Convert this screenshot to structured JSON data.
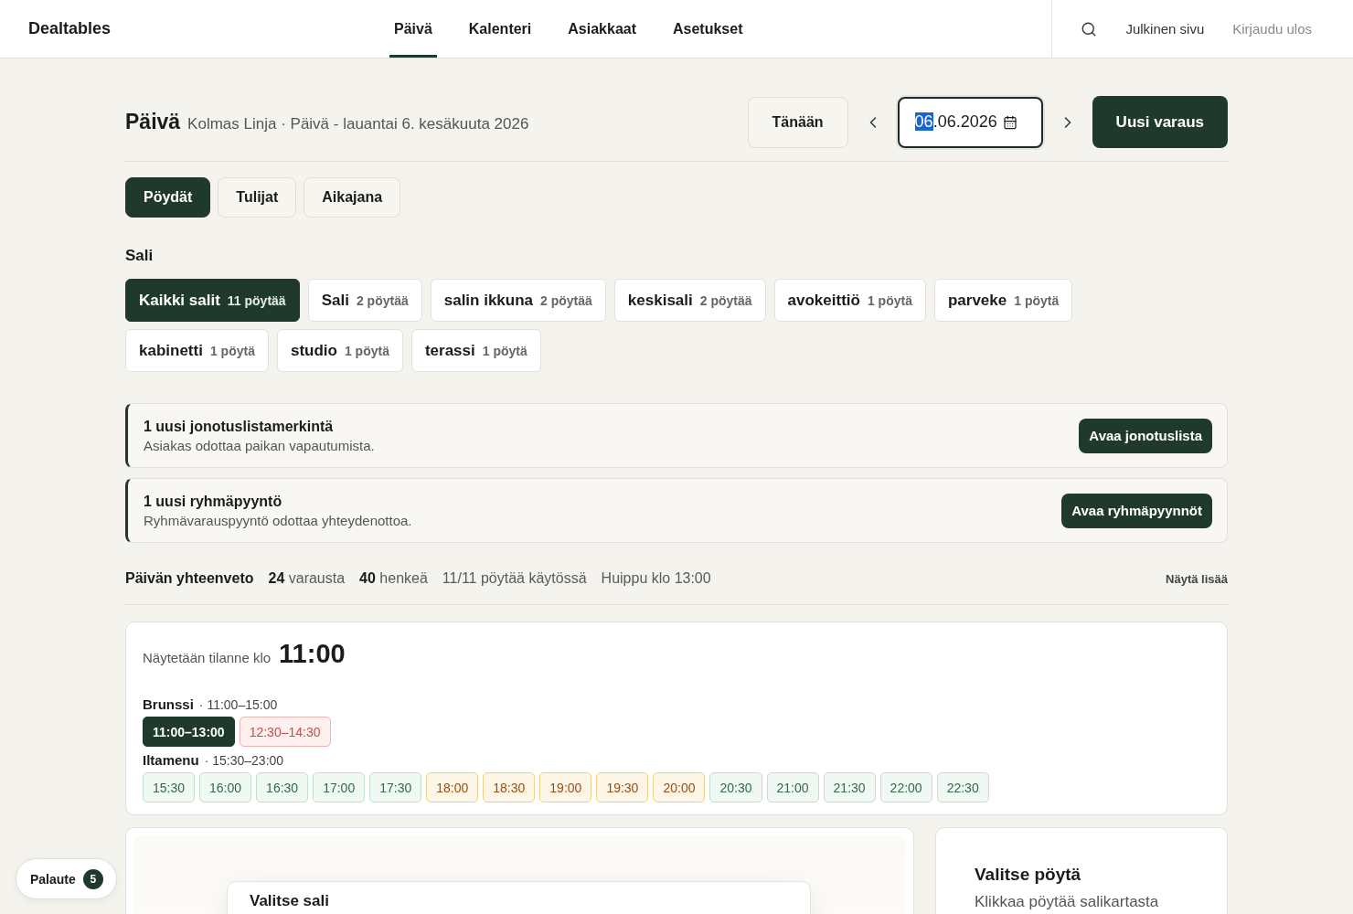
{
  "header": {
    "logo": "Dealtables",
    "nav": [
      {
        "label": "Päivä",
        "selected": true
      },
      {
        "label": "Kalenteri",
        "selected": false
      },
      {
        "label": "Asiakkaat",
        "selected": false
      },
      {
        "label": "Asetukset",
        "selected": false
      }
    ],
    "links": [
      {
        "label": "Julkinen sivu",
        "muted": false
      },
      {
        "label": "Kirjaudu ulos",
        "muted": true
      }
    ]
  },
  "page_header": {
    "title": "Päivä",
    "subtitle": "Kolmas Linja · Päivä - lauantai 6. kesäkuuta 2026",
    "today_button": "Tänään",
    "date_field": {
      "value": "06.06.2026",
      "focused": true
    },
    "new_button": "Uusi varaus"
  },
  "view_tabs": [
    {
      "label": "Pöydät",
      "selected": true
    },
    {
      "label": "Tulijat",
      "selected": false
    },
    {
      "label": "Aikajana",
      "selected": false
    }
  ],
  "halls": {
    "label": "Sali",
    "items": [
      {
        "name": "Kaikki salit",
        "count": "11 pöytää",
        "selected": true
      },
      {
        "name": "Sali",
        "count": "2 pöytää",
        "selected": false
      },
      {
        "name": "salin ikkuna",
        "count": "2 pöytää",
        "selected": false
      },
      {
        "name": "keskisali",
        "count": "2 pöytää",
        "selected": false
      },
      {
        "name": "avokeittiö",
        "count": "1 pöytä",
        "selected": false
      },
      {
        "name": "parveke",
        "count": "1 pöytä",
        "selected": false
      },
      {
        "name": "kabinetti",
        "count": "1 pöytä",
        "selected": false
      },
      {
        "name": "studio",
        "count": "1 pöytä",
        "selected": false
      },
      {
        "name": "terassi",
        "count": "1 pöytä",
        "selected": false
      }
    ]
  },
  "notices": [
    {
      "title": "1 uusi jonotuslistamerkintä",
      "text": "Asiakas odottaa paikan vapautumista.",
      "button": "Avaa jonotuslista"
    },
    {
      "title": "1 uusi ryhmäpyyntö",
      "text": "Ryhmävarauspyyntö odottaa yhteydenottoa.",
      "button": "Avaa ryhmäpyynnöt"
    }
  ],
  "summary": {
    "title": "Päivän yhteenveto",
    "stats": [
      "**24** varausta",
      "**40** henkeä",
      "11/11 pöytää käytössä",
      "Huippu klo 13:00"
    ],
    "more_link": "Näytä lisää"
  },
  "time_picker": {
    "label": "Näytetään tilanne klo",
    "time": "11:00",
    "services": [
      {
        "name": "Brunssi",
        "hours": "· 11:00–15:00",
        "slots": [
          {
            "time": "11:00–13:00",
            "selected": true
          },
          {
            "time": "12:30–14:30",
            "selected": false,
            "kind": "full"
          }
        ]
      },
      {
        "name": "Iltamenu",
        "hours": "· 15:30–23:00",
        "slots": [
          {
            "time": "15:30",
            "selected": false,
            "kind": "free"
          },
          {
            "time": "16:00",
            "selected": false,
            "kind": "free"
          },
          {
            "time": "16:30",
            "selected": false,
            "kind": "free"
          },
          {
            "time": "17:00",
            "selected": false,
            "kind": "free"
          },
          {
            "time": "17:30",
            "selected": false,
            "kind": "free"
          },
          {
            "time": "18:00",
            "selected": false,
            "kind": "busy"
          },
          {
            "time": "18:30",
            "selected": false,
            "kind": "busy"
          },
          {
            "time": "19:00",
            "selected": false,
            "kind": "busy"
          },
          {
            "time": "19:30",
            "selected": false,
            "kind": "busy"
          },
          {
            "time": "20:00",
            "selected": false,
            "kind": "busy"
          },
          {
            "time": "20:30",
            "selected": false,
            "kind": "free"
          },
          {
            "time": "21:00",
            "selected": false,
            "kind": "free"
          },
          {
            "time": "21:30",
            "selected": false,
            "kind": "free"
          },
          {
            "time": "22:00",
            "selected": false,
            "kind": "free"
          },
          {
            "time": "22:30",
            "selected": false,
            "kind": "free"
          }
        ]
      }
    ]
  },
  "floor_plan": {
    "dialog_title": "Valitse sali"
  },
  "table_panel": {
    "title": "Valitse pöytä",
    "text": "Klikkaa pöytää salikartasta"
  },
  "feedback_button": {
    "label": "Palaute",
    "count": "5"
  }
}
